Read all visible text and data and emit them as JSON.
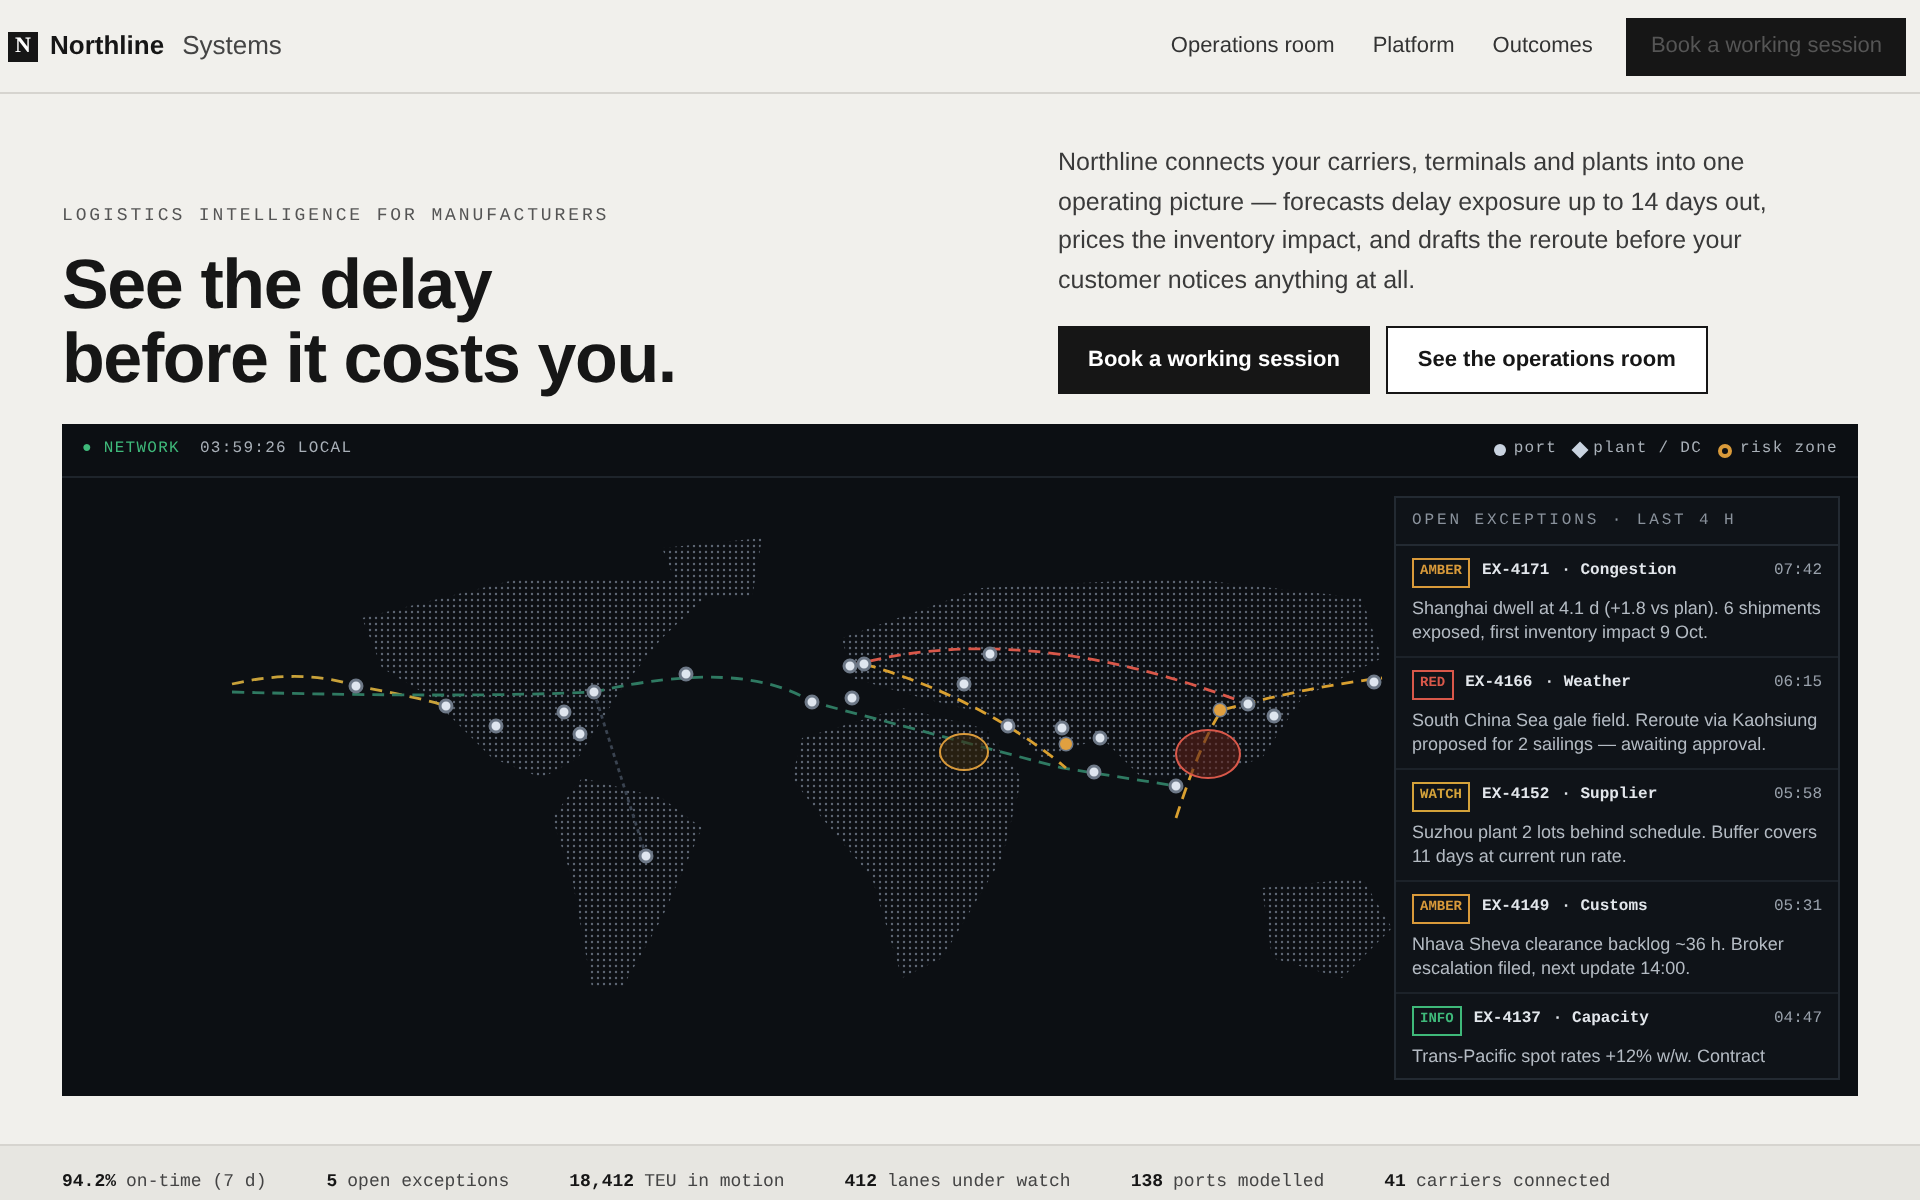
{
  "brand": {
    "logo": "N",
    "name": "Northline",
    "suffix": "Systems"
  },
  "nav": {
    "links": [
      "Operations room",
      "Platform",
      "Outcomes"
    ],
    "cta": "Book a working session"
  },
  "hero": {
    "eyebrow": "LOGISTICS INTELLIGENCE FOR MANUFACTURERS",
    "title_lines": [
      "See the delay",
      "before it costs you."
    ],
    "description": "Northline connects your carriers, terminals and plants into one operating picture — forecasts delay exposure up to 14 days out, prices the inventory impact, and drafts the reroute before your customer notices anything at all.",
    "buttons": [
      {
        "label": "Book a working session",
        "kind": "primary"
      },
      {
        "label": "See the operations room",
        "kind": "secondary"
      }
    ]
  },
  "map": {
    "status": "● NETWORK",
    "clock": "03:59:26 LOCAL",
    "legend": [
      {
        "label": "port",
        "kind": "port"
      },
      {
        "label": "plant / DC",
        "kind": "plant"
      },
      {
        "label": "risk zone",
        "kind": "risk"
      }
    ],
    "panel": {
      "title": "OPEN EXCEPTIONS · LAST 4 H",
      "items": [
        {
          "tag": "AMBER",
          "color": "#d99a3a",
          "id": "EX-4171",
          "category": "· Congestion",
          "time": "07:42",
          "text": "Shanghai dwell at 4.1 d (+1.8 vs plan). 6 shipments exposed, first inventory impact 9 Oct."
        },
        {
          "tag": "RED",
          "color": "#d9584a",
          "id": "EX-4166",
          "category": "· Weather",
          "time": "06:15",
          "text": "South China Sea gale field. Reroute via Kaohsiung proposed for 2 sailings — awaiting approval."
        },
        {
          "tag": "WATCH",
          "color": "#d4a23a",
          "id": "EX-4152",
          "category": "· Supplier",
          "time": "05:58",
          "text": "Suzhou plant 2 lots behind schedule. Buffer covers 11 days at current run rate."
        },
        {
          "tag": "AMBER",
          "color": "#d99a3a",
          "id": "EX-4149",
          "category": "· Customs",
          "time": "05:31",
          "text": "Nhava Sheva clearance backlog ~36 h. Broker escalation filed, next update 14:00."
        },
        {
          "tag": "INFO",
          "color": "#3fb97a",
          "id": "EX-4137",
          "category": "· Capacity",
          "time": "04:47",
          "text": "Trans-Pacific spot rates +12% w/w. Contract"
        }
      ]
    }
  },
  "stats": [
    {
      "value": "94.2%",
      "label": "on-time (7 d)"
    },
    {
      "value": "5",
      "label": "open exceptions"
    },
    {
      "value": "18,412",
      "label": "TEU in motion"
    },
    {
      "value": "412",
      "label": "lanes under watch"
    },
    {
      "value": "138",
      "label": "ports modelled"
    },
    {
      "value": "41",
      "label": "carriers connected"
    }
  ]
}
